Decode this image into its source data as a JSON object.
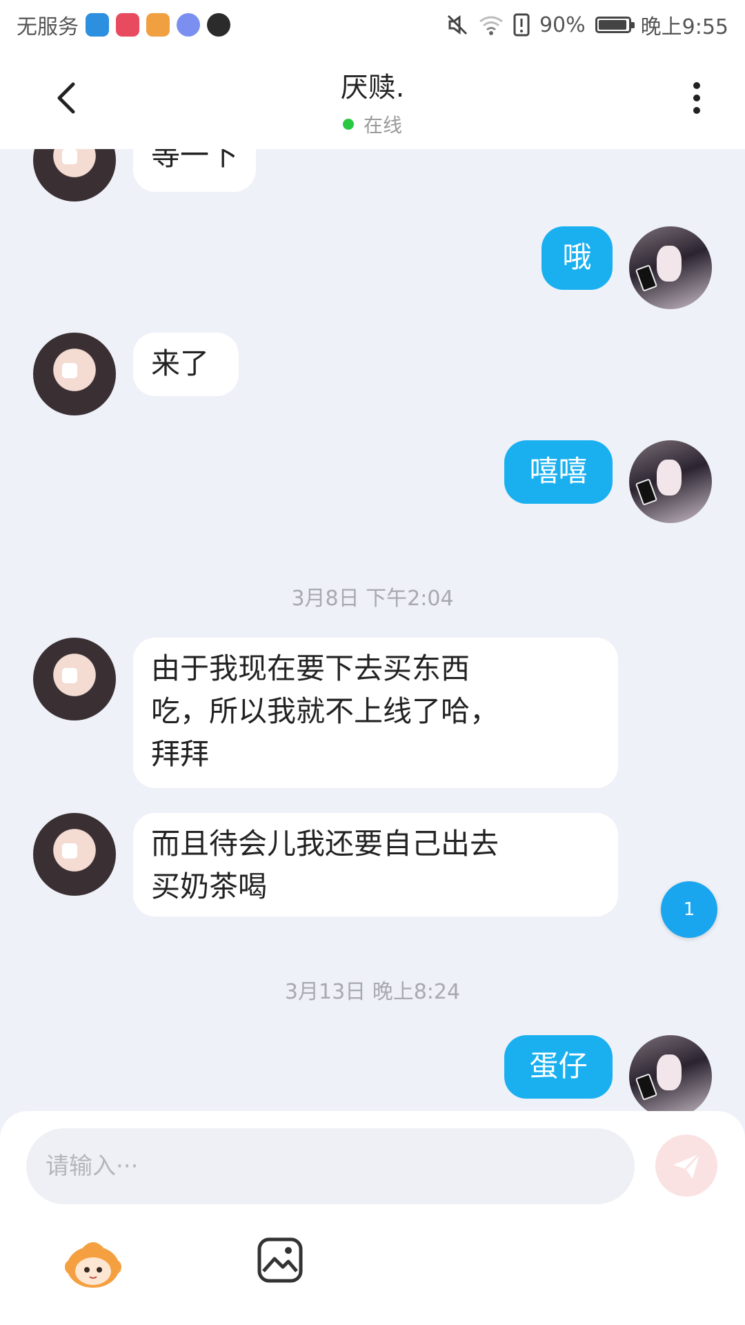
{
  "status_bar": {
    "carrier": "无服务",
    "battery": "90%",
    "time": "晚上9:55",
    "app_icon_colors": [
      "#2c8fe0",
      "#e84a5f",
      "#f0a040",
      "#7a8ff0",
      "#2b2b2b"
    ]
  },
  "header": {
    "title": "厌赎.",
    "status": "在线",
    "status_color": "#28c840"
  },
  "messages": {
    "m0": "等一下",
    "m1": "哦",
    "m2": "来了",
    "m3": "嘻嘻",
    "ts1": "3月8日  下午2:04",
    "m4_line1": "由于我现在要下去买东西",
    "m4_line2": "吃，所以我就不上线了哈，",
    "m4_line3": "拜拜",
    "m5_line1": "而且待会儿我还要自己出去",
    "m5_line2": "买奶茶喝",
    "ts2": "3月13日  晚上8:24",
    "m6": "蛋仔"
  },
  "unread_badge": "1",
  "composer": {
    "placeholder": "请输入···"
  },
  "colors": {
    "accent": "#1ab0f0",
    "send_disabled": "#fbe2e2",
    "background": "#eef1f8"
  }
}
